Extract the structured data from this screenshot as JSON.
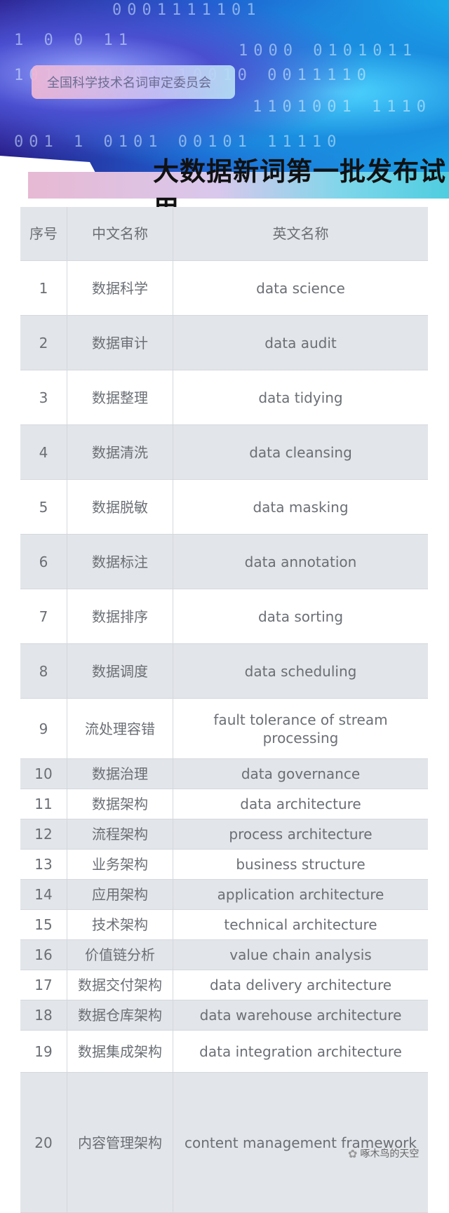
{
  "header": {
    "organization": "全国科学技术名词审定委员会",
    "title": "大数据新词第一批发布试用"
  },
  "table": {
    "columns": [
      "序号",
      "中文名称",
      "英文名称"
    ],
    "rows": [
      [
        "1",
        "数据科学",
        "data science"
      ],
      [
        "2",
        "数据审计",
        "data audit"
      ],
      [
        "3",
        "数据整理",
        "data tidying"
      ],
      [
        "4",
        "数据清洗",
        "data cleansing"
      ],
      [
        "5",
        "数据脱敏",
        "data masking"
      ],
      [
        "6",
        "数据标注",
        "data annotation"
      ],
      [
        "7",
        "数据排序",
        "data sorting"
      ],
      [
        "8",
        "数据调度",
        "data scheduling"
      ],
      [
        "9",
        "流处理容错",
        "fault tolerance of stream processing"
      ],
      [
        "10",
        "数据治理",
        "data governance"
      ],
      [
        "11",
        "数据架构",
        "data architecture"
      ],
      [
        "12",
        "流程架构",
        "process architecture"
      ],
      [
        "13",
        "业务架构",
        "business structure"
      ],
      [
        "14",
        "应用架构",
        "application architecture"
      ],
      [
        "15",
        "技术架构",
        "technical architecture"
      ],
      [
        "16",
        "价值链分析",
        "value chain analysis"
      ],
      [
        "17",
        "数据交付架构",
        "data delivery architecture"
      ],
      [
        "18",
        "数据仓库架构",
        "data warehouse architecture"
      ],
      [
        "19",
        "数据集成架构",
        "data integration architecture"
      ],
      [
        "20",
        "内容管理架构",
        "content management framework"
      ]
    ]
  },
  "watermark": {
    "icon": "wechat-icon",
    "text": "啄木鸟的天空"
  }
}
